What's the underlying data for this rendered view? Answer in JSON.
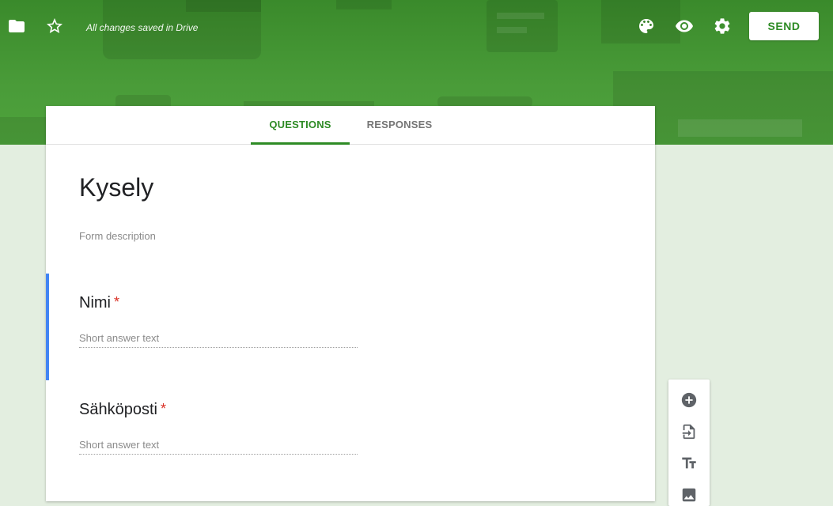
{
  "toolbar": {
    "saved_status": "All changes saved in Drive",
    "send_label": "SEND",
    "icons": [
      "folder-icon",
      "star-icon",
      "palette-icon",
      "eye-icon",
      "gear-icon"
    ]
  },
  "tabs": [
    {
      "label": "QUESTIONS",
      "active": true
    },
    {
      "label": "RESPONSES",
      "active": false
    }
  ],
  "form": {
    "title": "Kysely",
    "description_placeholder": "Form description"
  },
  "questions": [
    {
      "title": "Nimi",
      "required_mark": "*",
      "answer_placeholder": "Short answer text"
    },
    {
      "title": "Sähköposti",
      "required_mark": "*",
      "answer_placeholder": "Short answer text"
    }
  ],
  "side_toolbar": {
    "icons": [
      "add-circle-icon",
      "import-questions-icon",
      "title-text-icon",
      "image-icon"
    ]
  },
  "colors": {
    "brand_green": "#2e8b25",
    "header_green": "#4a9c39",
    "background": "#e3eee0",
    "focus_blue": "#4285f4",
    "required_red": "#d93025"
  }
}
